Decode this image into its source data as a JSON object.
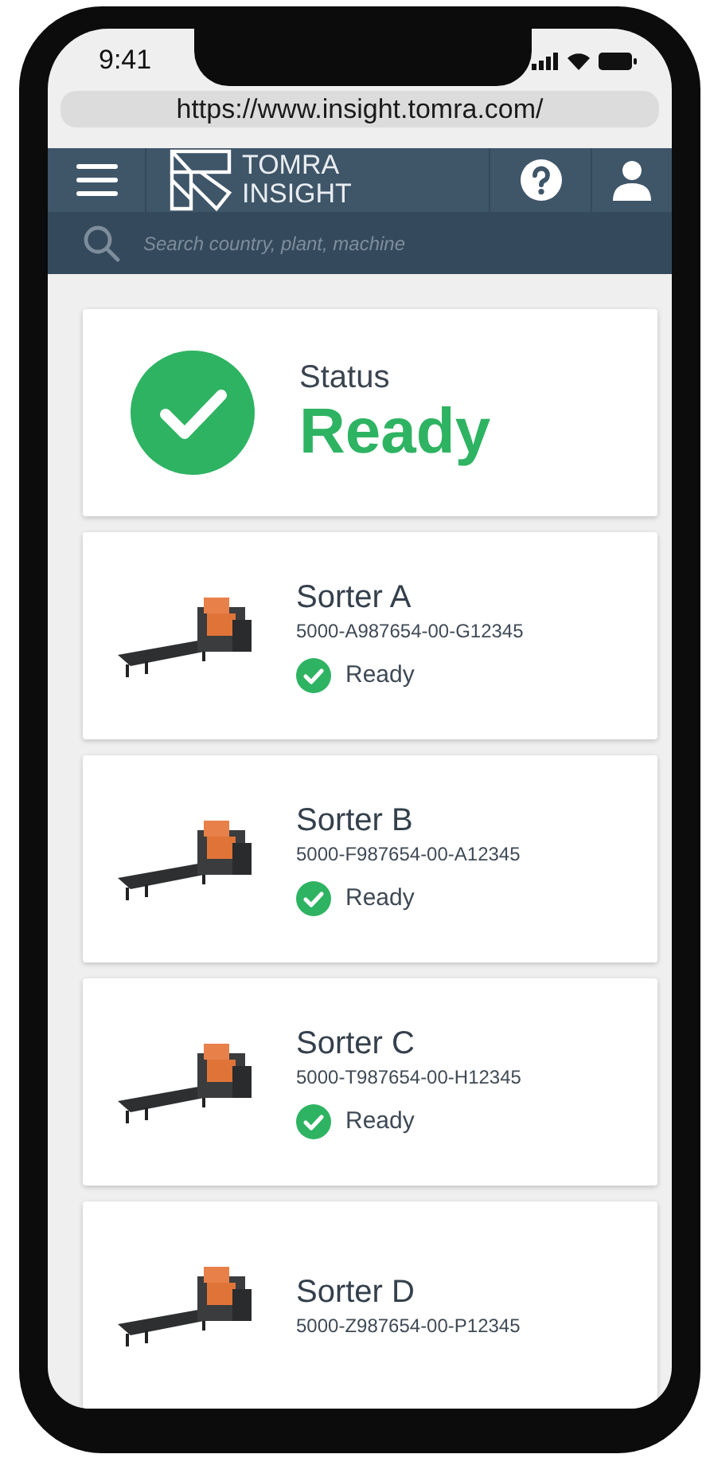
{
  "status_bar": {
    "time": "9:41"
  },
  "browser": {
    "url": "https://www.insight.tomra.com/"
  },
  "header": {
    "logo_line_1": "TOMRA",
    "logo_line_2": "INSIGHT"
  },
  "search": {
    "placeholder": "Search country, plant, machine"
  },
  "overall_status": {
    "label": "Status",
    "value": "Ready",
    "kind": "ready"
  },
  "machines": [
    {
      "name": "Sorter A",
      "serial": "5000-A987654-00-G12345",
      "status": {
        "kind": "ready",
        "label": "Ready"
      }
    },
    {
      "name": "Sorter B",
      "serial": "5000-F987654-00-A12345",
      "status": {
        "kind": "ready",
        "label": "Ready"
      }
    },
    {
      "name": "Sorter C",
      "serial": "5000-T987654-00-H12345",
      "status": {
        "kind": "ready",
        "label": "Ready"
      }
    },
    {
      "name": "Sorter D",
      "serial": "5000-Z987654-00-P12345"
    }
  ]
}
